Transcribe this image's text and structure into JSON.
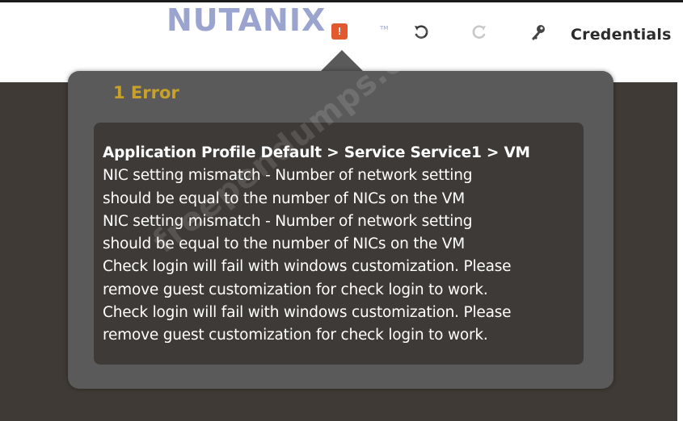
{
  "header": {
    "logo_text": "NUTANIX",
    "logo_tm": "TM",
    "error_badge_icon": "warning-icon",
    "error_badge_glyph": "!",
    "undo_icon": "undo-icon",
    "redo_icon": "redo-icon",
    "key_icon": "key-icon",
    "credentials_label": "Credentials"
  },
  "error_popover": {
    "title": "1 Error",
    "heading": "Application Profile Default > Service Service1 > VM",
    "lines": [
      "NIC setting mismatch - Number of network setting",
      "should be equal to the number of NICs on the VM",
      "NIC setting mismatch - Number of network setting",
      "should be equal to the number of NICs on the VM",
      "Check login will fail with windows customization. Please",
      "remove guest customization for check login to work.",
      "Check login will fail with windows customization. Please",
      "remove guest customization for check login to work."
    ]
  },
  "watermark": "freependumps.com",
  "colors": {
    "logo": "#9aa4ce",
    "error_badge": "#e2592f",
    "error_title": "#c8a12a",
    "popover_bg": "#5a5a5a",
    "message_bg": "#3e3a37",
    "canvas_bg": "#3f3a35"
  }
}
